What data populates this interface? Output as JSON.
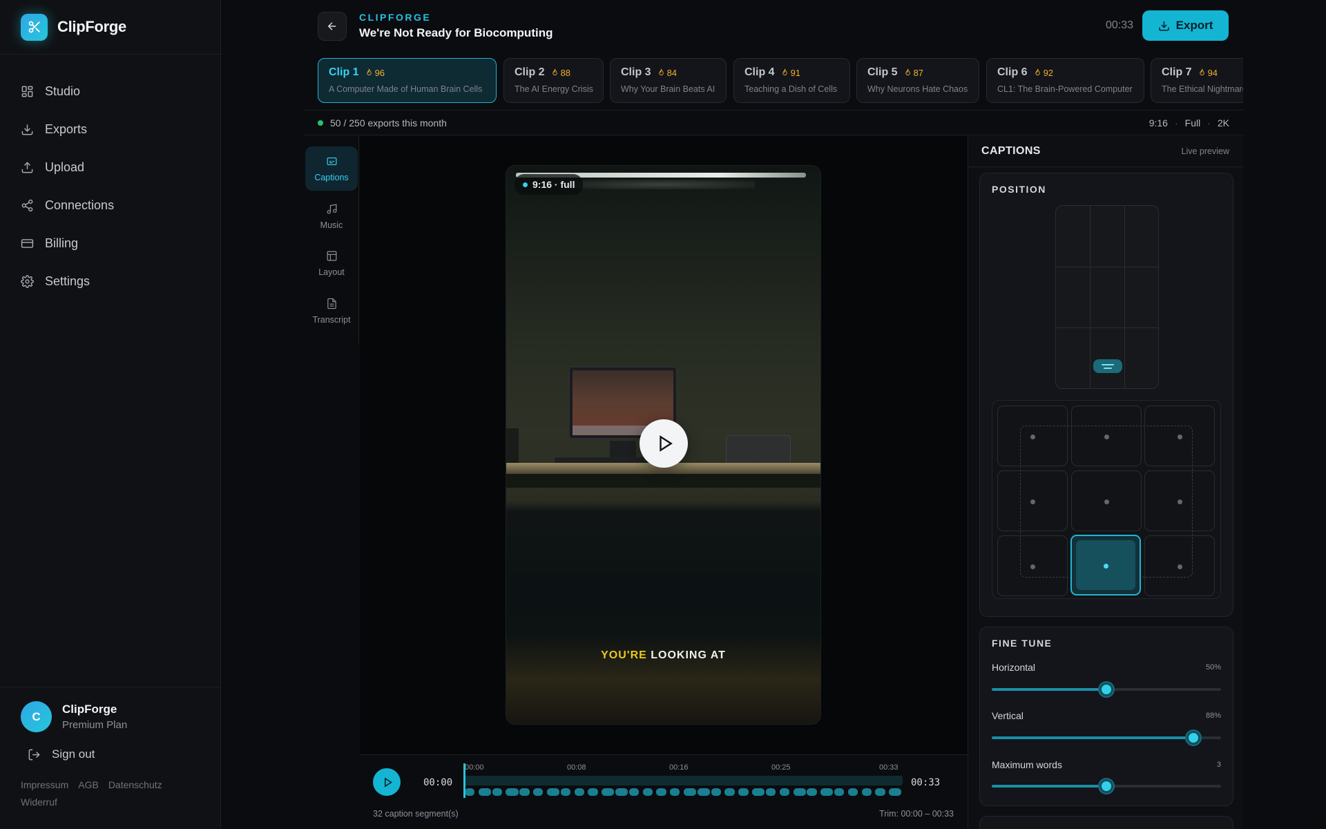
{
  "brand": {
    "name": "ClipForge"
  },
  "nav": [
    {
      "label": "Studio",
      "icon": "grid-icon"
    },
    {
      "label": "Exports",
      "icon": "download-icon"
    },
    {
      "label": "Upload",
      "icon": "upload-icon"
    },
    {
      "label": "Connections",
      "icon": "share-icon"
    },
    {
      "label": "Billing",
      "icon": "card-icon"
    },
    {
      "label": "Settings",
      "icon": "gear-icon"
    }
  ],
  "user": {
    "initial": "C",
    "name": "ClipForge",
    "plan": "Premium Plan"
  },
  "signout": "Sign out",
  "legal": [
    "Impressum",
    "AGB",
    "Datenschutz",
    "Widerruf"
  ],
  "header": {
    "kicker": "CLIPFORGE",
    "title": "We're Not Ready for Biocomputing",
    "time": "00:33",
    "export_label": "Export"
  },
  "clips": [
    {
      "label": "Clip 1",
      "score": "96",
      "title": "A Computer Made of Human Brain Cells",
      "active": true
    },
    {
      "label": "Clip 2",
      "score": "88",
      "title": "The AI Energy Crisis"
    },
    {
      "label": "Clip 3",
      "score": "84",
      "title": "Why Your Brain Beats AI"
    },
    {
      "label": "Clip 4",
      "score": "91",
      "title": "Teaching a Dish of Cells"
    },
    {
      "label": "Clip 5",
      "score": "87",
      "title": "Why Neurons Hate Chaos"
    },
    {
      "label": "Clip 6",
      "score": "92",
      "title": "CL1: The Brain-Powered Computer"
    },
    {
      "label": "Clip 7",
      "score": "94",
      "title": "The Ethical Nightmare"
    }
  ],
  "status": {
    "text": "50 / 250 exports this month",
    "aspect": "9:16",
    "mode": "Full",
    "quality": "2K",
    "sep": "·"
  },
  "rail": [
    {
      "label": "Captions",
      "icon": "captions-icon",
      "active": true
    },
    {
      "label": "Music",
      "icon": "music-icon"
    },
    {
      "label": "Layout",
      "icon": "layout-icon"
    },
    {
      "label": "Transcript",
      "icon": "transcript-icon"
    }
  ],
  "preview": {
    "aspect_pill": "9:16 · full",
    "caption_highlight": "YOU'RE",
    "caption_rest": "LOOKING AT"
  },
  "timeline": {
    "current": "00:00",
    "end": "00:33",
    "ticks": [
      "00:00",
      "00:08",
      "00:16",
      "00:25",
      "00:33"
    ],
    "segments_label": "32 caption segment(s)",
    "trim": "Trim: 00:00 – 00:33",
    "segment_count": 32
  },
  "panel": {
    "title": "CAPTIONS",
    "live": "Live preview",
    "position_title": "POSITION",
    "selected_cell": "bottom-center",
    "finetune_title": "FINE TUNE",
    "sliders": [
      {
        "label": "Horizontal",
        "value_text": "50%",
        "fraction": 0.5
      },
      {
        "label": "Vertical",
        "value_text": "88%",
        "fraction": 0.88
      },
      {
        "label": "Maximum words",
        "value_text": "3",
        "fraction": 0.5
      }
    ]
  },
  "colors": {
    "accent": "#13b5d3",
    "score": "#f3b02b",
    "caption_highlight": "#e9c91b",
    "status_ok": "#22c46e"
  }
}
